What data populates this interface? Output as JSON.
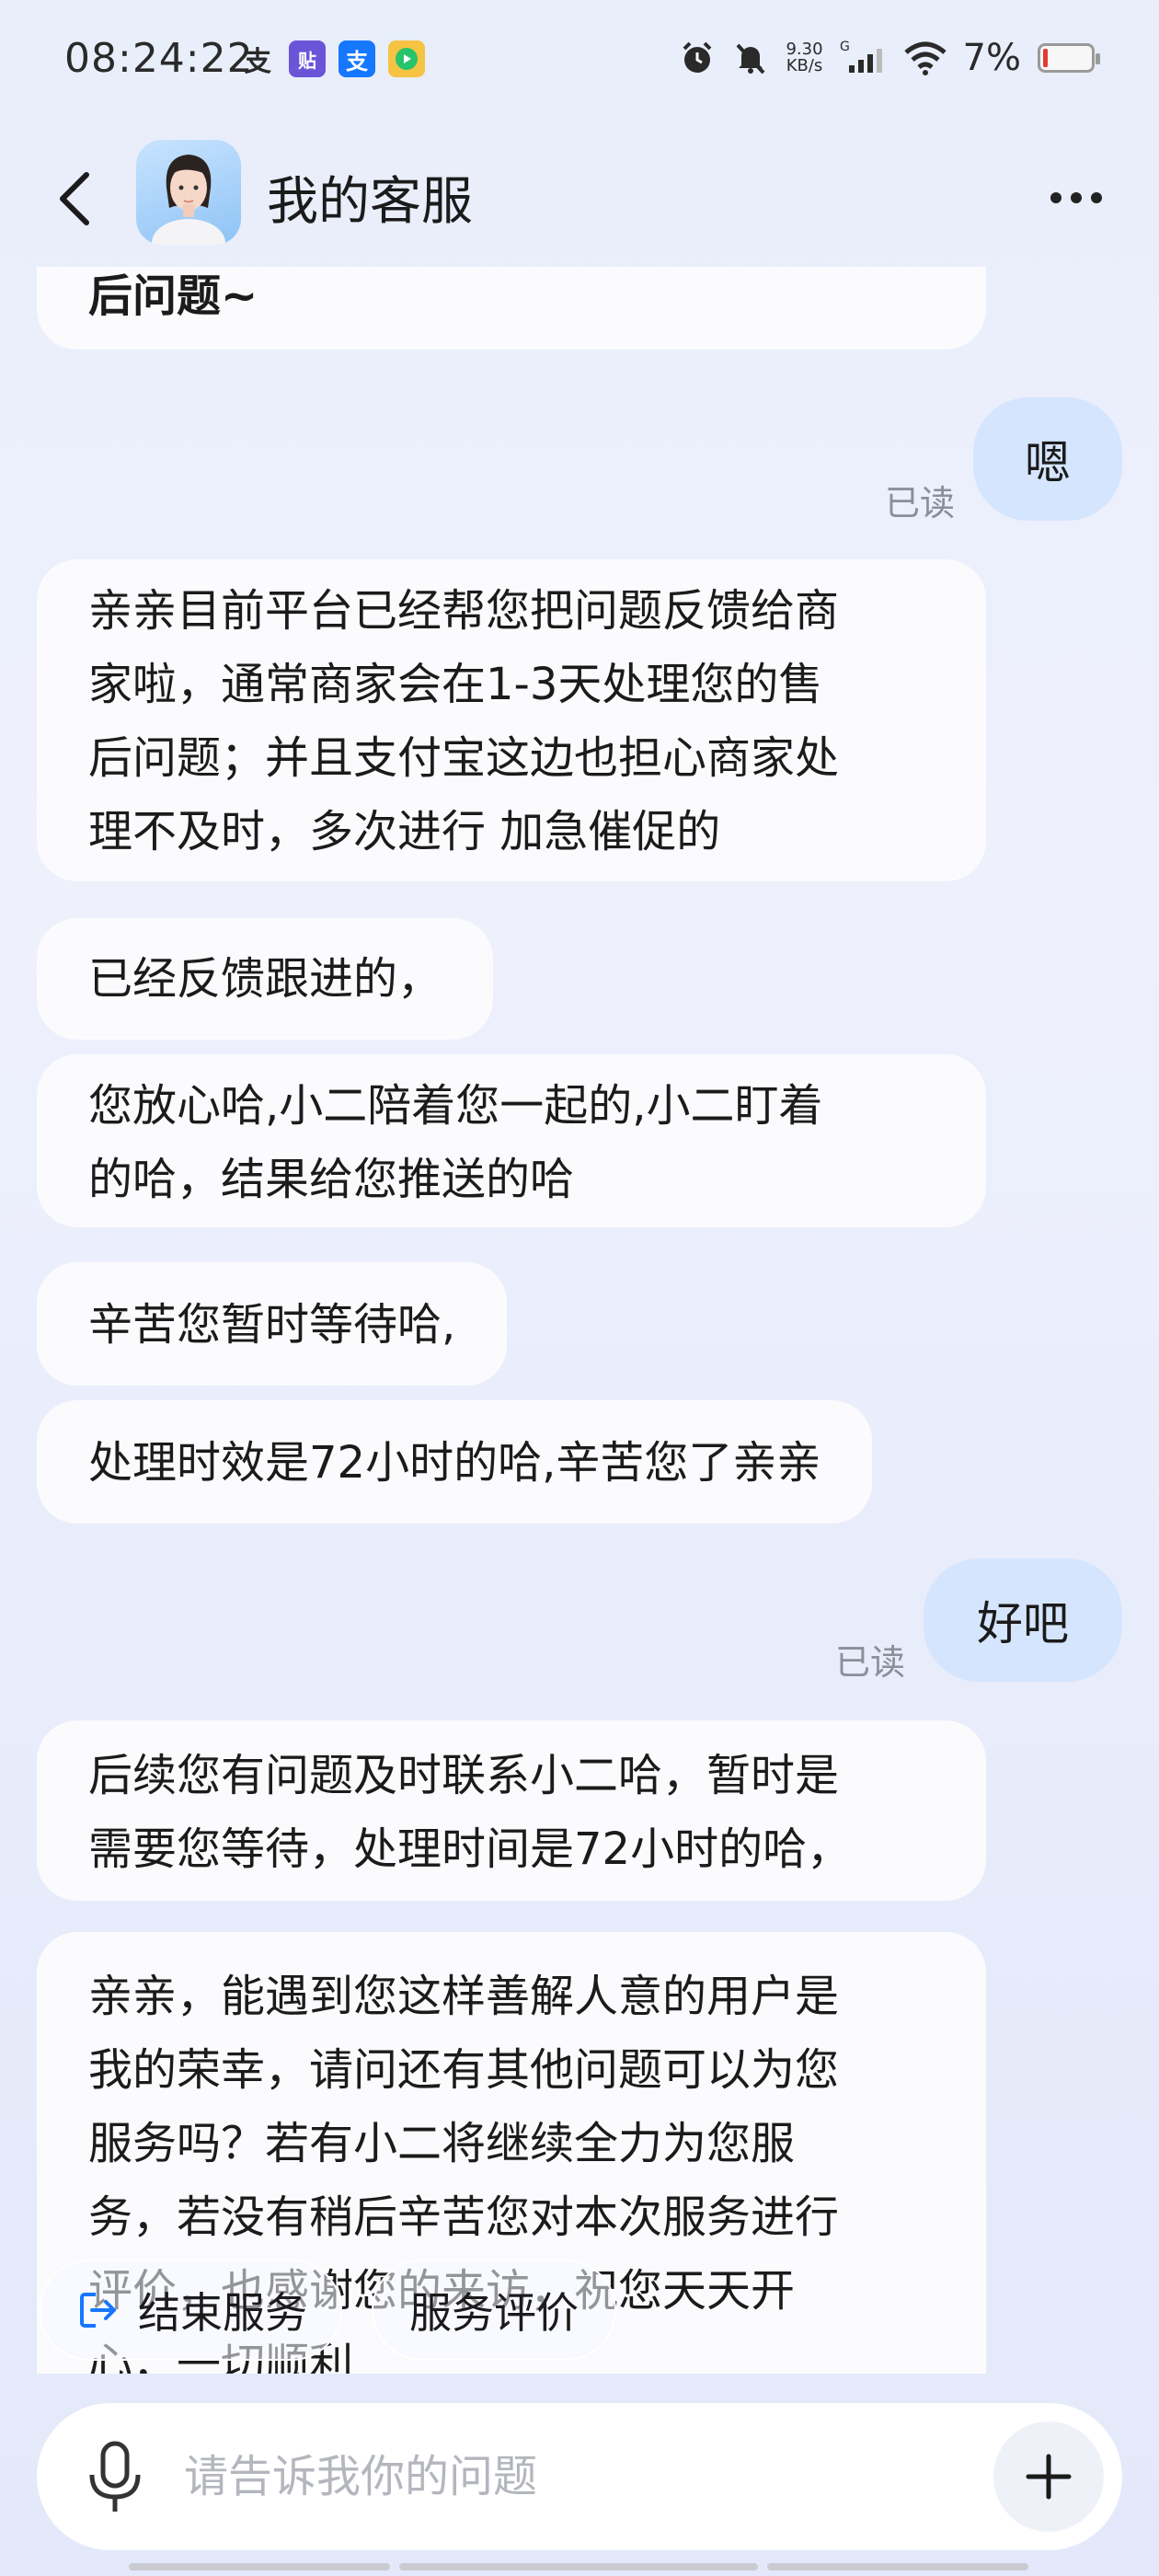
{
  "status_bar": {
    "time": "08:24:22",
    "net_speed_value": "9.30",
    "net_speed_unit": "KB/s",
    "network": "G",
    "battery": "7%"
  },
  "header": {
    "title": "我的客服"
  },
  "messages": [
    {
      "from": "agent",
      "text": "后问题~"
    },
    {
      "from": "user",
      "text": "嗯",
      "status": "已读"
    },
    {
      "from": "agent",
      "lines": [
        "亲亲目前平台已经帮您把问题反馈给商",
        "家啦，通常商家会在1-3天处理您的售",
        "后问题；并且支付宝这边也担心商家处",
        "理不及时，多次进行 加急催促的"
      ]
    },
    {
      "from": "agent",
      "text": "已经反馈跟进的，"
    },
    {
      "from": "agent",
      "lines": [
        "您放心哈,小二陪着您一起的,小二盯着",
        "的哈，结果给您推送的哈"
      ]
    },
    {
      "from": "agent",
      "text": "辛苦您暂时等待哈,"
    },
    {
      "from": "agent",
      "text": "处理时效是72小时的哈,辛苦您了亲亲"
    },
    {
      "from": "user",
      "text": "好吧",
      "status": "已读"
    },
    {
      "from": "agent",
      "lines": [
        "后续您有问题及时联系小二哈，暂时是",
        "需要您等待，处理时间是72小时的哈，"
      ]
    },
    {
      "from": "agent",
      "lines": [
        "亲亲，能遇到您这样善解人意的用户是",
        "我的荣幸，请问还有其他问题可以为您",
        "服务吗？若有小二将继续全力为您服",
        "务，若没有稍后辛苦您对本次服务进行",
        "评价，也感谢您的来访，祝您天天开",
        "心，一切顺利"
      ]
    }
  ],
  "quick_actions": {
    "end_service": "结束服务",
    "rate_service": "服务评价"
  },
  "input": {
    "placeholder": "请告诉我你的问题"
  }
}
